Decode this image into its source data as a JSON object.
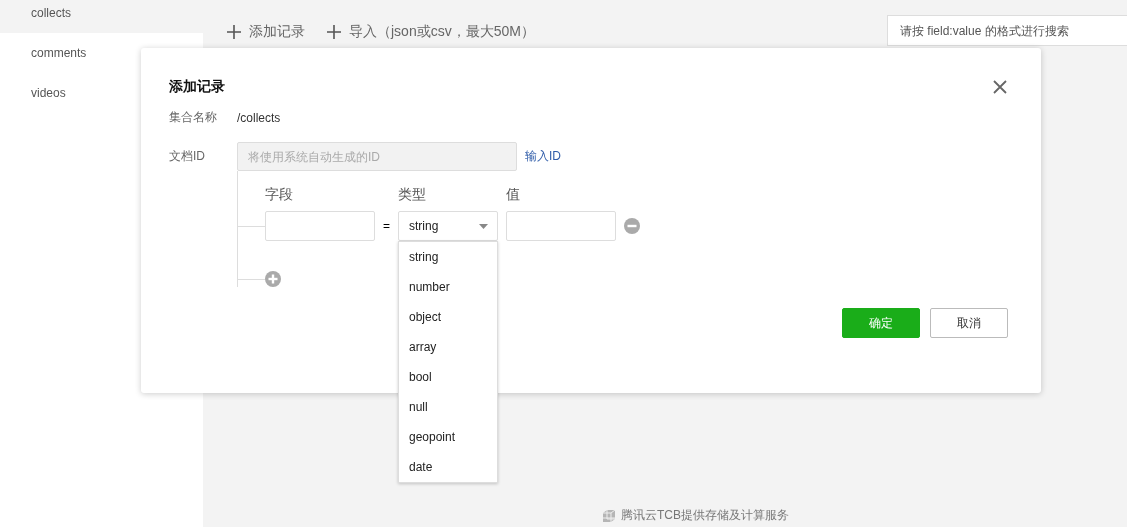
{
  "sidebar": {
    "items": [
      {
        "label": "collects",
        "selected": true
      },
      {
        "label": "comments",
        "selected": false
      },
      {
        "label": "videos",
        "selected": false
      }
    ]
  },
  "toolbar": {
    "buttons": [
      {
        "label": "添加记录"
      },
      {
        "label": "导入（json或csv，最大50M）"
      }
    ]
  },
  "search": {
    "placeholder": "请按 field:value 的格式进行搜索"
  },
  "dialog": {
    "title": "添加记录",
    "collection": {
      "label": "集合名称",
      "value": "/collects"
    },
    "doc_id": {
      "label": "文档ID",
      "placeholder": "将使用系统自动生成的ID",
      "disabled": true,
      "link": "输入ID"
    },
    "headers": [
      "字段",
      "类型",
      "值"
    ],
    "rows": [
      {
        "equals": "=",
        "type": "string"
      }
    ],
    "dropdown": {
      "expanded": true,
      "options": [
        "string",
        "number",
        "object",
        "array",
        "bool",
        "null",
        "geopoint",
        "date"
      ]
    },
    "buttons": [
      {
        "label": "确定",
        "kind": "primary"
      },
      {
        "label": "取消",
        "kind": "default"
      }
    ]
  },
  "footer": {
    "text": "腾讯云TCB提供存储及计算服务"
  }
}
